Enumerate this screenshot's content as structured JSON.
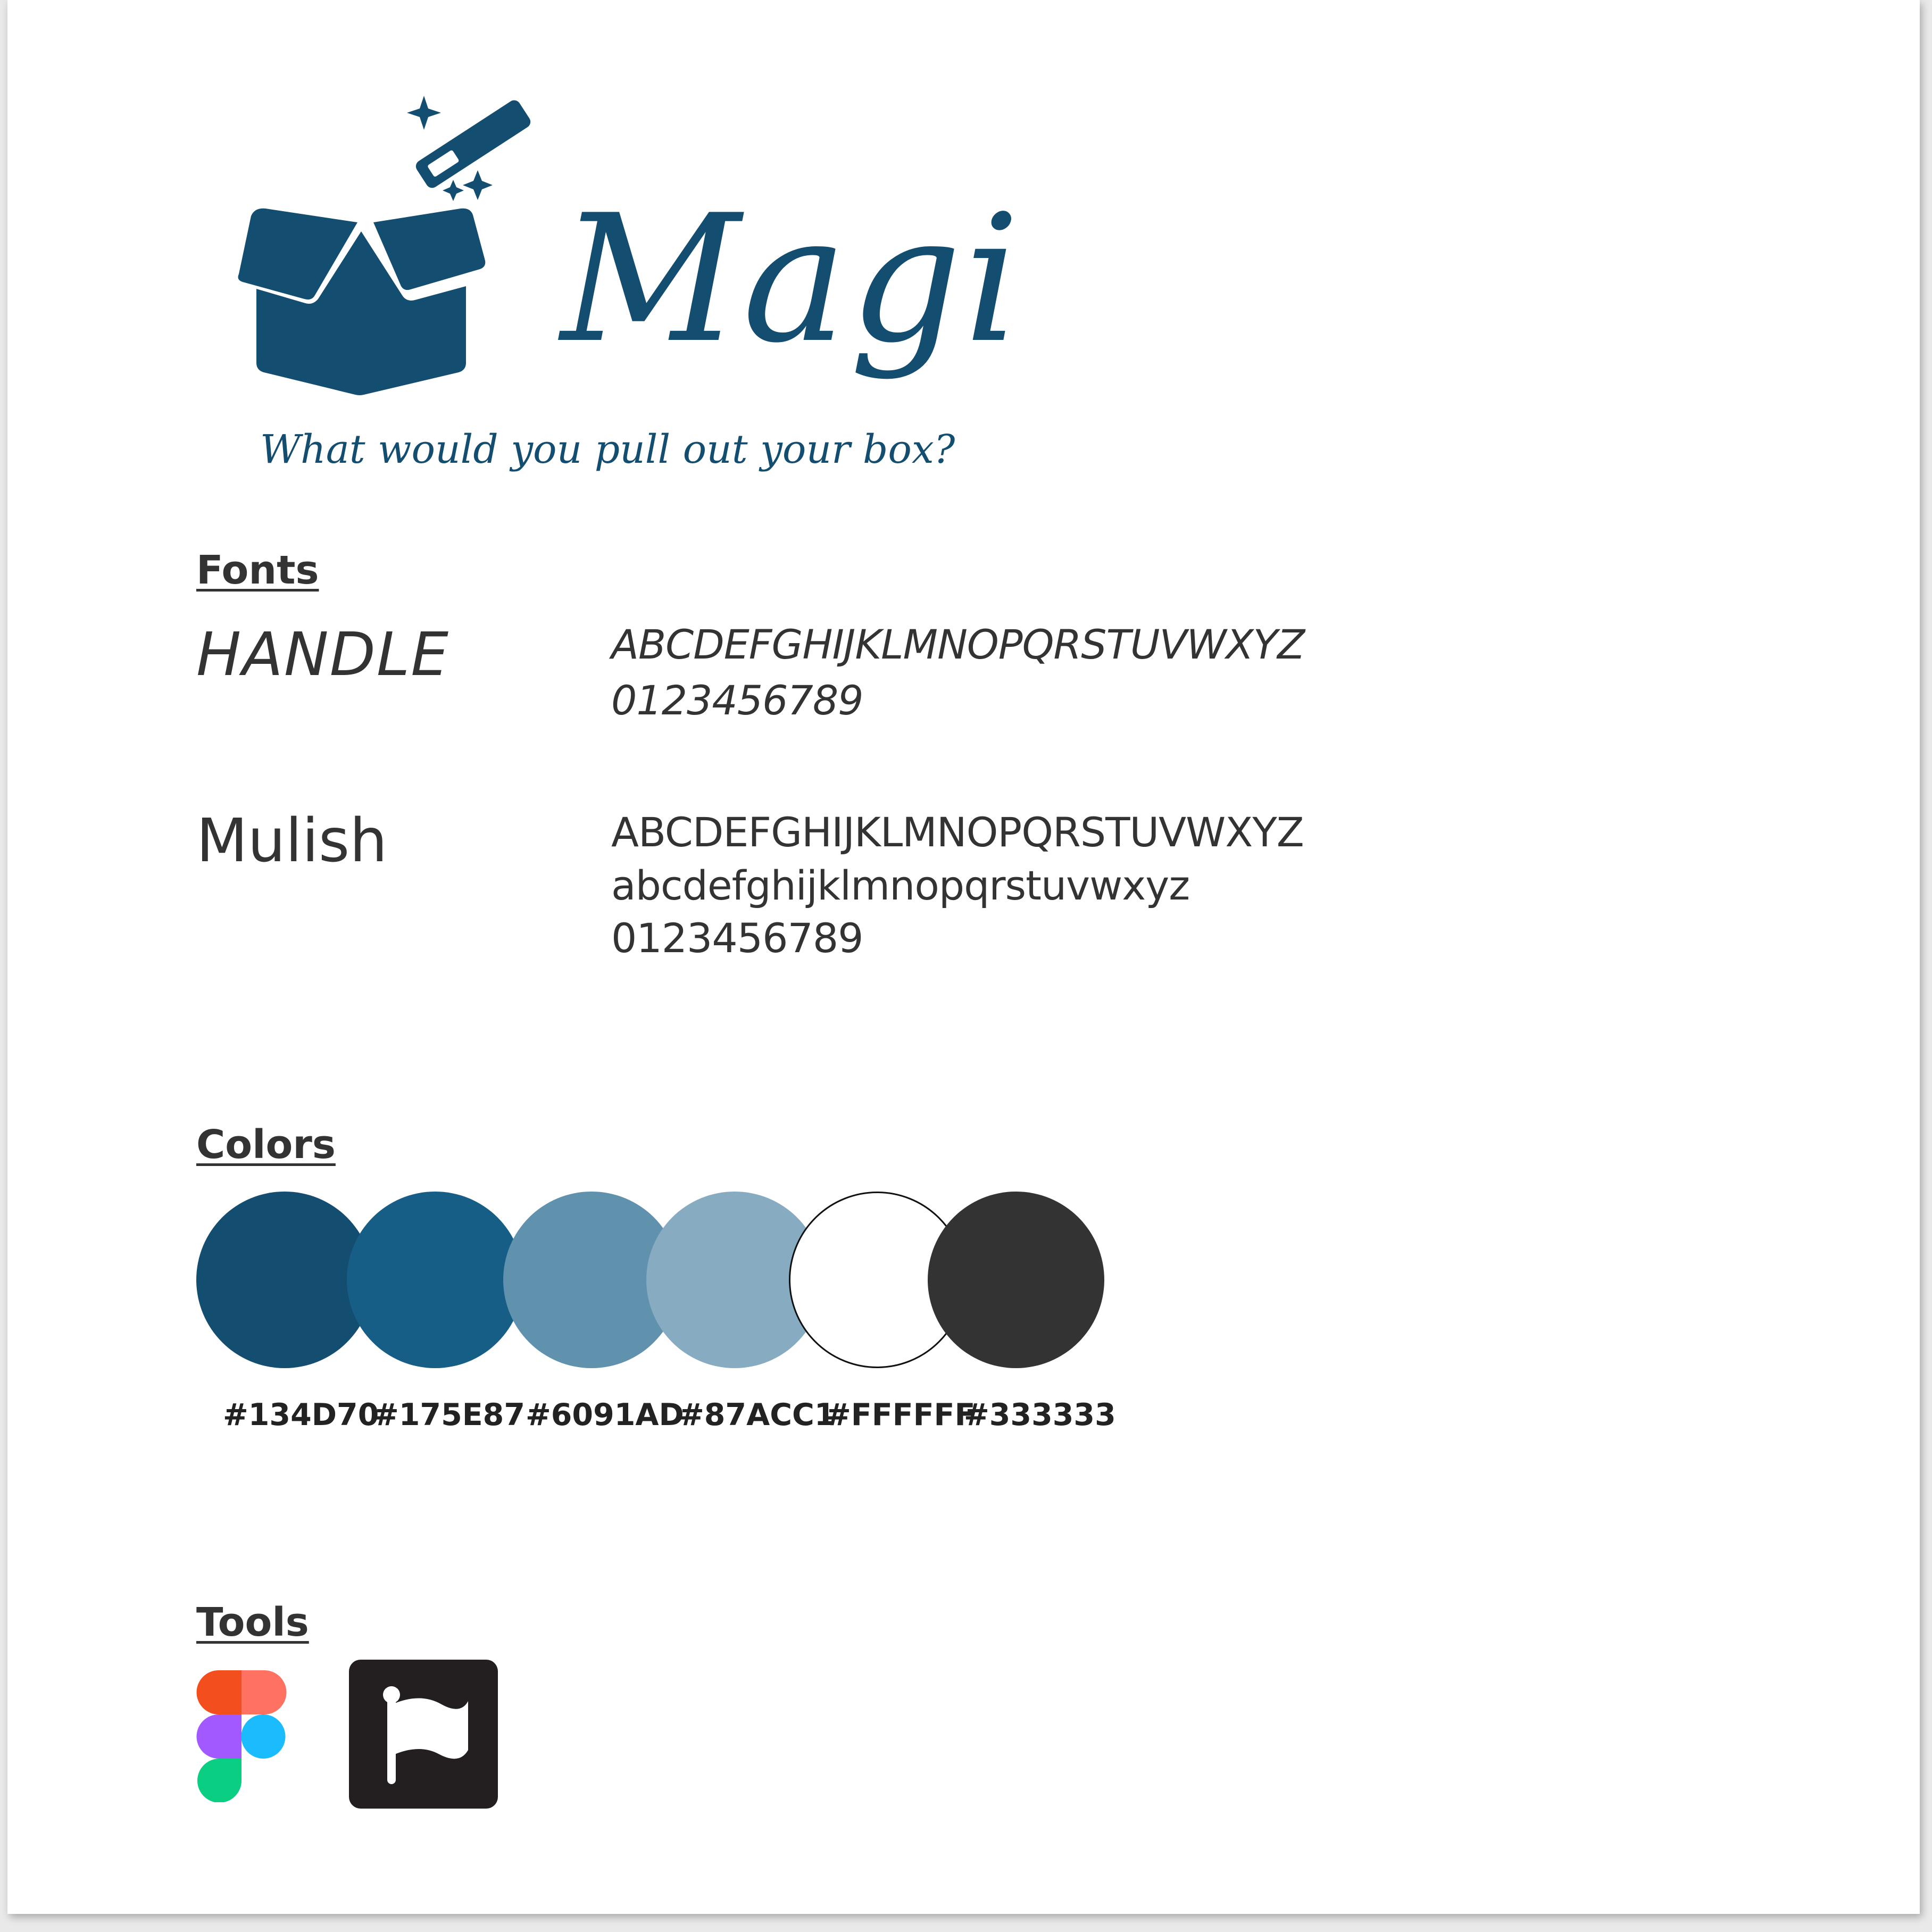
{
  "brand": {
    "name": "Magi",
    "tagline": "What would you pull out your box?",
    "logo_icon": "magic-box-icon",
    "color": "#134D70"
  },
  "fonts": {
    "heading": "Fonts",
    "items": [
      {
        "name": "HANDLE",
        "uppercase": "ABCDEFGHIJKLMNOPQRSTUVWXYZ",
        "digits": "0123456789"
      },
      {
        "name": "Mulish",
        "uppercase": "ABCDEFGHIJKLMNOPQRSTUVWXYZ",
        "lowercase": "abcdefghijklmnopqrstuvwxyz",
        "digits": "0123456789"
      }
    ]
  },
  "colors": {
    "heading": "Colors",
    "swatches": [
      {
        "hex": "#134D70",
        "label": "#134D70"
      },
      {
        "hex": "#175E87",
        "label": "#175E87"
      },
      {
        "hex": "#6091AD",
        "label": "#6091AD"
      },
      {
        "hex": "#87ACC1",
        "label": "#87ACC1"
      },
      {
        "hex": "#FFFFFF",
        "label": "#FFFFFF"
      },
      {
        "hex": "#333333",
        "label": "#333333"
      }
    ]
  },
  "tools": {
    "heading": "Tools",
    "items": [
      {
        "icon": "figma-icon"
      },
      {
        "icon": "flag-app-icon"
      }
    ]
  }
}
